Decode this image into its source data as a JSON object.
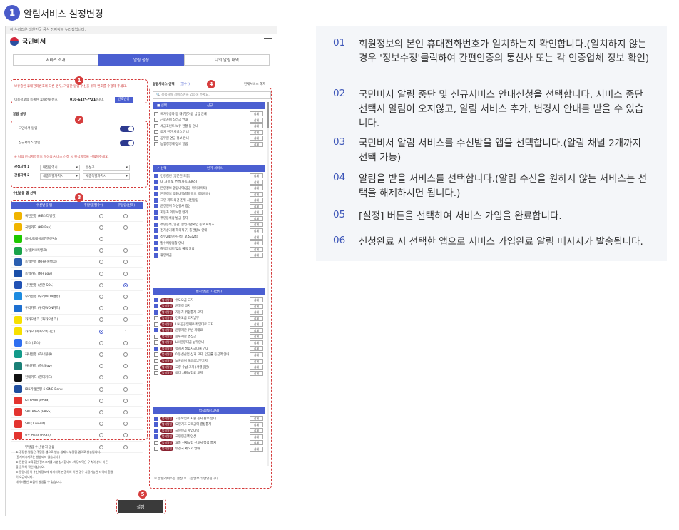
{
  "header": {
    "step": "1",
    "title": "알림서비스 설정변경"
  },
  "phone": {
    "gov_banner": "이 누리집은 대한민국 공식 전자정부 누리집입니다.",
    "brand": "국민비서",
    "tabs": [
      "서비스 소개",
      "알림 설정",
      "나의 알림 내역"
    ],
    "markers": [
      "1",
      "2",
      "3",
      "4",
      "5"
    ],
    "phone_notice": "보유중인 휴대전화번호와 다른 경우, 가입한 알림 수신을 위해 번호를 수정해 주세요.",
    "phone_label": "이용정보의 등록된 휴대전화번호",
    "phone_number": "010-642*-**21",
    "phone_suffix": "입니다.",
    "phone_btn": "번호변경",
    "alarm_title": "알림 설정",
    "toggles": [
      {
        "label": "국민비서 알림",
        "on": true
      },
      {
        "label": "신규서비스 알림",
        "on": true
      }
    ],
    "region_notice": "※ 나의 관심지역정보 분야의 서비스 신청 시 관심지역을 선택해주세요.",
    "regions": [
      {
        "label": "관심지역 1",
        "sido": "대전광역시",
        "sigungu": "유성구"
      },
      {
        "label": "관심지역 2",
        "sido": "세종특별자치시",
        "sigungu": "세종특별자치시"
      }
    ],
    "app_title": "수신받을 앱 선택",
    "app_cols": [
      "수신받을 앱",
      "주알림(필수*)",
      "부알림(선택)"
    ],
    "apps": [
      {
        "name": "국민은행 (KB스타뱅킹)",
        "color": "#f0b400",
        "main": false,
        "sub": "radio"
      },
      {
        "name": "국민카드 (KB Pay)",
        "color": "#f0b400",
        "main": false,
        "sub": "radio"
      },
      {
        "name": "네이버(네이버전자문서)",
        "color": "#1ec800",
        "main": false,
        "sub": "dash"
      },
      {
        "name": "농협(NH콕뱅크)",
        "color": "#1aa34a",
        "main": false,
        "sub": "radio"
      },
      {
        "name": "농협은행 (NH올원뱅크)",
        "color": "#2b5fb0",
        "main": false,
        "sub": "radio"
      },
      {
        "name": "농협카드 (NH pay)",
        "color": "#1b4fa8",
        "main": false,
        "sub": "radio"
      },
      {
        "name": "신한은행 (신한 SOL)",
        "color": "#2253b5",
        "main": false,
        "sub": "on"
      },
      {
        "name": "우리은행 (우리WON뱅킹)",
        "color": "#1d8be0",
        "main": false,
        "sub": "radio"
      },
      {
        "name": "우리카드 (우리WON카드)",
        "color": "#1d6fd0",
        "main": false,
        "sub": "radio"
      },
      {
        "name": "카카오뱅크 (카카오뱅크)",
        "color": "#f7e000",
        "main": false,
        "sub": "radio"
      },
      {
        "name": "카카오 (카카오톡지갑)",
        "color": "#f7e000",
        "main": true,
        "sub": "dash"
      },
      {
        "name": "토스 (토스)",
        "color": "#2f6ff0",
        "main": false,
        "sub": "radio"
      },
      {
        "name": "하나은행 (하나원큐)",
        "color": "#139a8a",
        "main": false,
        "sub": "radio"
      },
      {
        "name": "하나카드 (하나Pay)",
        "color": "#1a7f76",
        "main": false,
        "sub": "radio"
      },
      {
        "name": "현대카드 (현대카드)",
        "color": "#111111",
        "main": false,
        "sub": "radio"
      },
      {
        "name": "IBK기업은행 (i-ONE Bank)",
        "color": "#1f4e9e",
        "main": false,
        "sub": "radio"
      },
      {
        "name": "KT PASS (PASS)",
        "color": "#e3342f",
        "main": false,
        "sub": "radio"
      },
      {
        "name": "SKT PASS (PASS)",
        "color": "#e3342f",
        "main": false,
        "sub": "radio"
      },
      {
        "name": "SKT(T world)",
        "color": "#e3342f",
        "main": false,
        "sub": "radio"
      },
      {
        "name": "U+ PASS (PASS)",
        "color": "#e3342f",
        "main": false,
        "sub": "radio"
      },
      {
        "name": "부알림 수신 받지 않음",
        "color": "",
        "main": false,
        "sub": "radio"
      }
    ],
    "notes": [
      "① 경정한 알림은 주알림 앱으로 발송 실패시 부알림 앱으로 발송됩니다.",
      "(문자메시지로는 발송되지 않습니다.)",
      "② 민원위 교육훈련 전자고지를 시범실시합니다. 해당지역은 우측의 상세 버튼",
      "을 클릭해 확인하십시오.",
      "③ 알림내용이 수신자정보에 따라하며 판결하여 이런 경우 사용가능한 데이터 환경",
      "이 요금되니다.",
      "데이터통신 요금이 발생할 수 있습니다."
    ],
    "svc_title": "알림서비스 선택",
    "svc_title_sub": "(필수*)",
    "svc_select_all": "전체서비스 해지",
    "search_placeholder": "검색하실 서비스명을 입력해 주세요.",
    "svc_head": [
      "선택",
      "신규"
    ],
    "svc_new": [
      {
        "name": "국가유공자 등 대부분이급 납입 안내",
        "on": false
      },
      {
        "name": "근로자녀 장려금 안내",
        "on": false
      },
      {
        "name": "세금포인트 보유 현황 등 안내",
        "on": false
      },
      {
        "name": "조기 진전 서비스 안내",
        "on": false
      },
      {
        "name": "공무원 연금 정보 안내",
        "on": false
      },
      {
        "name": "농업경영체 정보 알림",
        "on": false
      }
    ],
    "svc_pop_head": [
      "선택",
      "인기 서비스"
    ],
    "svc_pop": [
      {
        "name": "건강검진 (방문진 포함)",
        "on": true
      },
      {
        "name": "내 차 정보 변경(자동차365)",
        "on": true
      },
      {
        "name": "본인정보 열람내역(공공 마이데이터)",
        "on": true
      },
      {
        "name": "본인정보 조회내역(행정정보 공동이용)",
        "on": true
      },
      {
        "name": "국민 피프 의견 진위 사전알림",
        "on": true
      },
      {
        "name": "운전면허 적성검사 갱신",
        "on": true
      },
      {
        "name": "자동차 의무보험 만기",
        "on": true
      },
      {
        "name": "주민등록증 발급 통지",
        "on": true
      },
      {
        "name": "주민등록, 인감, 본인서명확인 통보 서비스",
        "on": true
      },
      {
        "name": "전자상거래(해외직구) 통관정보 안내",
        "on": true
      },
      {
        "name": "청부24(민원신청, 보조금24)",
        "on": true
      },
      {
        "name": "필수예방접종 안내",
        "on": true
      },
      {
        "name": "혜택알리미 맞춤 혜택 알림",
        "on": true
      },
      {
        "name": "휴면예금",
        "on": true
      }
    ],
    "svc_fine_head": "범칙알림(고지납부)",
    "svc_fine": [
      {
        "tag": "법칙알림",
        "name": "수도요금 고지",
        "on": true
      },
      {
        "tag": "법칙알림",
        "name": "운열정 고지",
        "on": true
      },
      {
        "tag": "법칙알림",
        "name": "자동차 위험통제 고지",
        "on": true
      },
      {
        "tag": "법칙알림",
        "name": "전화요금 고지납부",
        "on": false
      },
      {
        "tag": "법칙알림",
        "name": "LH 공공임대주택 임대료 고지",
        "on": false
      },
      {
        "tag": "법칙알림",
        "name": "운행제한 위반 과태료",
        "on": true
      },
      {
        "tag": "법칙알림",
        "name": "운류제한 변상금",
        "on": false
      },
      {
        "tag": "법칙알림",
        "name": "LH 분양대금 납부안내",
        "on": false
      },
      {
        "tag": "법칙알림",
        "name": "유제시 생활지급대출 안내",
        "on": true
      },
      {
        "tag": "법칙알림",
        "name": "이동신산업 상가 고지, 입금률 등금액 안내",
        "on": false
      },
      {
        "tag": "법칙알림",
        "name": "보훈급여 예금금납부고지",
        "on": false
      },
      {
        "tag": "법칙알림",
        "name": "교량 수납 고지 (서령공원)",
        "on": false
      },
      {
        "tag": "법칙알림",
        "name": "로대 사회보험료 고지",
        "on": false
      }
    ],
    "svc_fine2_head": "범칙알림(고지)",
    "svc_fine2": [
      {
        "tag": "법칙알림",
        "name": "고용보험료 지원 통지 환수 안내",
        "on": true
      },
      {
        "tag": "법칙알림",
        "name": "요민기초 교육급여 결정통지",
        "on": true
      },
      {
        "tag": "법칙알림",
        "name": "국민연금 개임내역",
        "on": true
      },
      {
        "tag": "법칙알림",
        "name": "국민연금액 인상",
        "on": true
      },
      {
        "tag": "법칙알림",
        "name": "교통 선제보험 신고서/통합 통지",
        "on": false
      },
      {
        "tag": "법칙알림",
        "name": "무선국 제허가 안내",
        "on": false
      }
    ],
    "detail_btn": "상세",
    "svc_note": "① 알림서비스는 설정 후 다음날부터 반영됩니다.",
    "set_btn": "설정"
  },
  "guide": [
    {
      "n": "01",
      "text": "회원정보의 본인 휴대전화번호가 일치하는지 확인합니다.(일치하지 않는 경우 '정보수정'클릭하여 간편인증의 통신사 또는 각 인증업체 정보 확인)"
    },
    {
      "n": "02",
      "text": "국민비서 알림 중단 및 신규서비스 안내신청을 선택합니다. 서비스 중단 선택시 알림이 오지않고, 알림 서비스 추가, 변경시 안내를 받을 수 있습니다."
    },
    {
      "n": "03",
      "text": "국민비서 알림 서비스를 수신받을 앱을 선택합니다.(알림 채널 2개까지 선택 가능)"
    },
    {
      "n": "04",
      "text": "알림을 받을 서비스를 선택합니다.(알림 수신을 원하지 않는 서비스는 선택을 해제하시면 됩니다.)"
    },
    {
      "n": "05",
      "text": "[설정] 버튼을 선택하여 서비스 가입을 완료합니다."
    },
    {
      "n": "06",
      "text": "신청완료 시 선택한 앱으로 서비스 가입완료 알림 메시지가 발송됩니다."
    }
  ]
}
